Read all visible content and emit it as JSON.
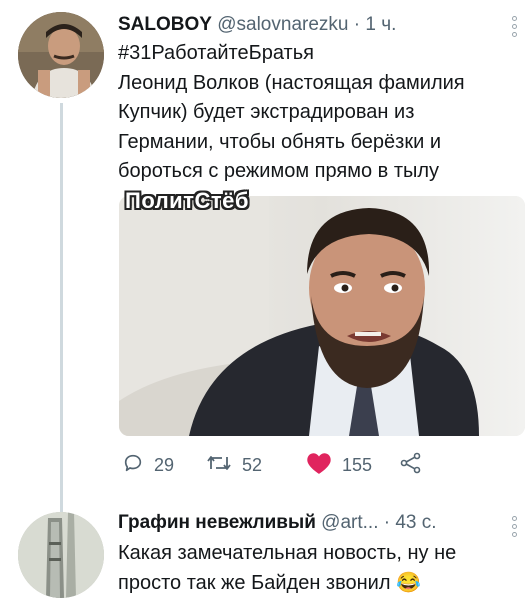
{
  "tweets": [
    {
      "author_name": "SALOBOY",
      "handle": "@salovnarezku",
      "separator": "·",
      "time": "1 ч.",
      "lines": [
        "#31РаботайтеБратья",
        "Леонид Волков (настоящая фамилия",
        "Купчик) будет экстрадирован из",
        "Германии, чтобы обнять берёзки и",
        "бороться с режимом прямо в тылу"
      ],
      "media_watermark": "ПолитСтёб",
      "stats": {
        "replies": "29",
        "retweets": "52",
        "likes": "155"
      }
    },
    {
      "author_name": "Графин невежливый",
      "handle": "@art...",
      "separator": "·",
      "time": "43 с.",
      "lines": [
        "Какая замечательная новость, ну не",
        "просто так же Байден звонил 😂"
      ]
    }
  ],
  "icons": {
    "reply": "reply-icon",
    "retweet": "retweet-icon",
    "like": "heart-icon",
    "share": "share-icon",
    "menu": "more-vertical-icon"
  },
  "colors": {
    "text": "#14171a",
    "secondary": "#536471",
    "like_active": "#e0245e",
    "thread_line": "#cfd9de"
  }
}
